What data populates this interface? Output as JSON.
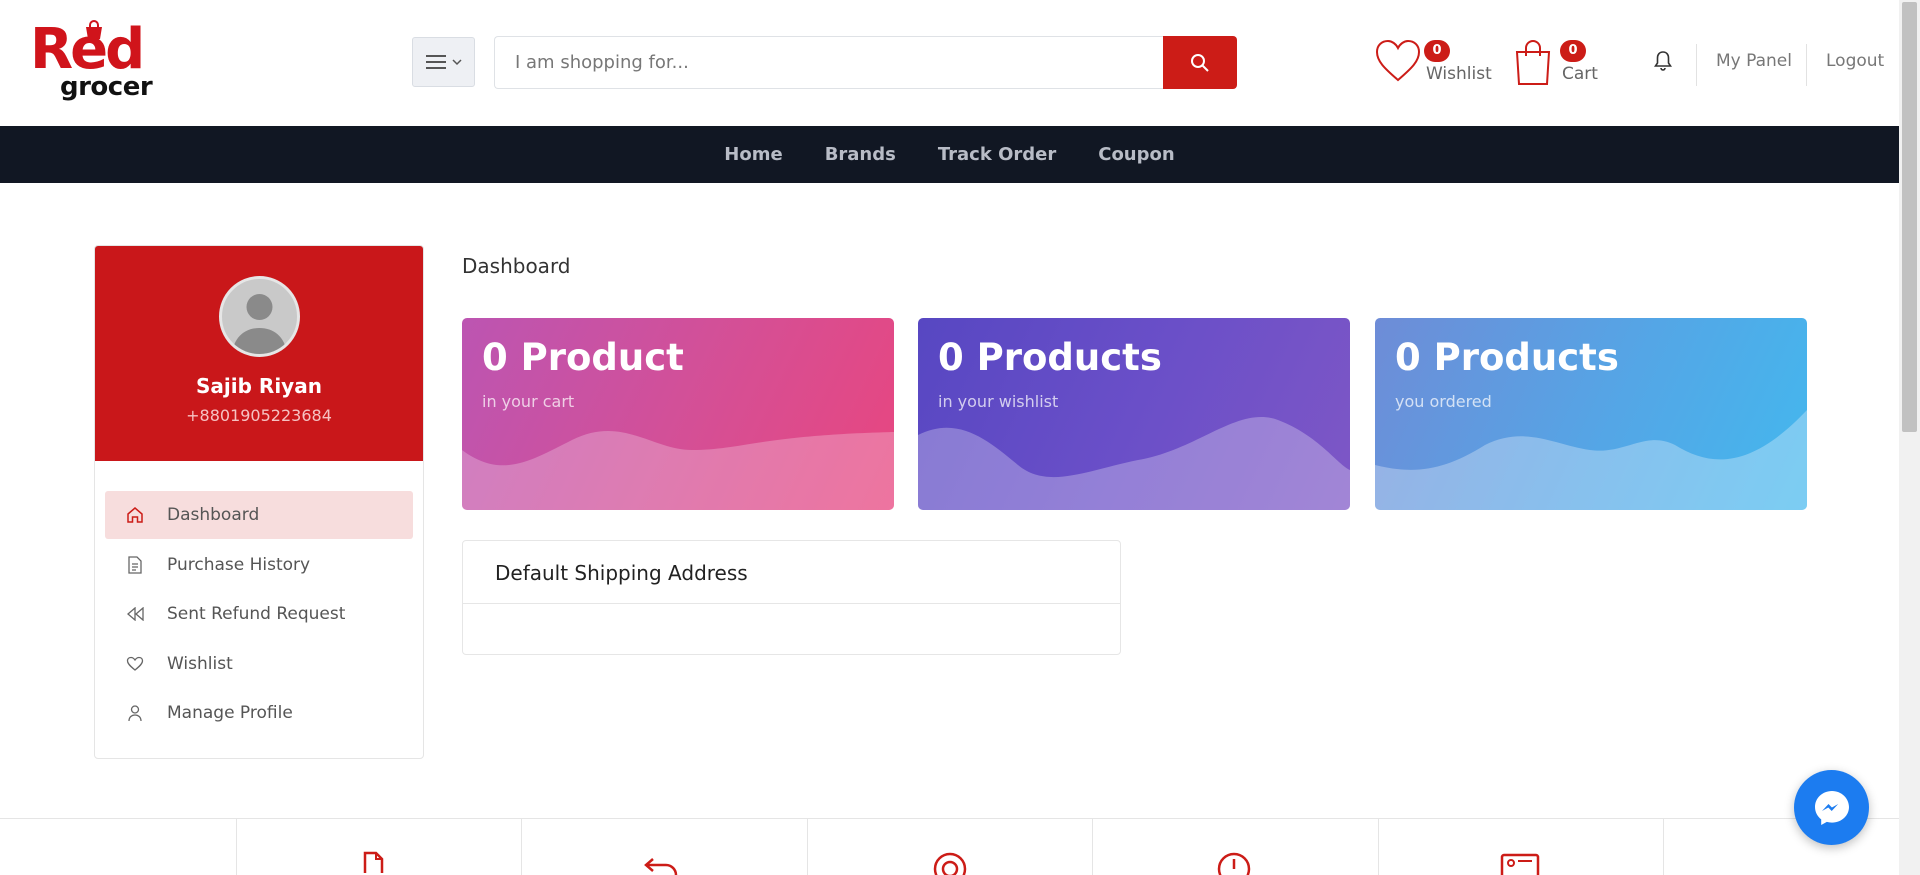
{
  "header": {
    "logo_text": "Red grocer",
    "search_placeholder": "I am shopping for...",
    "wishlist": {
      "label": "Wishlist",
      "count": "0"
    },
    "cart": {
      "label": "Cart",
      "count": "0"
    },
    "links": {
      "my_panel": "My Panel",
      "logout": "Logout"
    }
  },
  "navbar": {
    "items": [
      "Home",
      "Brands",
      "Track Order",
      "Coupon"
    ]
  },
  "sidebar": {
    "profile": {
      "name": "Sajib Riyan",
      "phone": "+8801905223684"
    },
    "items": [
      {
        "label": "Dashboard",
        "icon": "home-icon",
        "active": true
      },
      {
        "label": "Purchase History",
        "icon": "document-icon",
        "active": false
      },
      {
        "label": "Sent Refund Request",
        "icon": "rewind-icon",
        "active": false
      },
      {
        "label": "Wishlist",
        "icon": "heart-icon",
        "active": false
      },
      {
        "label": "Manage Profile",
        "icon": "user-icon",
        "active": false
      }
    ]
  },
  "main": {
    "title": "Dashboard",
    "cards": [
      {
        "count": "0 Product",
        "caption": "in your cart"
      },
      {
        "count": "0 Products",
        "caption": "in your wishlist"
      },
      {
        "count": "0 Products",
        "caption": "you ordered"
      }
    ],
    "shipping": {
      "title": "Default Shipping Address"
    }
  },
  "features": [
    "document-icon",
    "return-arrow-icon",
    "lifebuoy-icon",
    "info-icon",
    "id-card-icon"
  ],
  "colors": {
    "brand": "#cc1c17",
    "navbar": "#111723",
    "active_item_bg": "#f7dddd"
  }
}
